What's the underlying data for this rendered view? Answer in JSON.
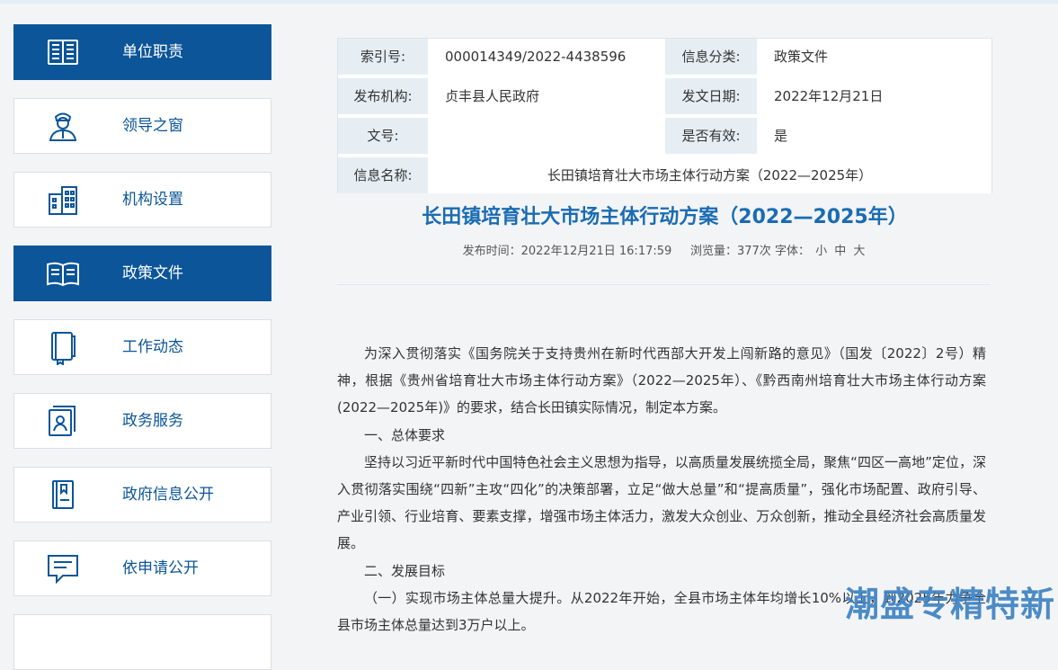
{
  "sidebar": {
    "items": [
      {
        "label": "单位职责",
        "icon": "book-list-icon",
        "active": true
      },
      {
        "label": "领导之窗",
        "icon": "leader-person-icon",
        "active": false
      },
      {
        "label": "机构设置",
        "icon": "building-icon",
        "active": false
      },
      {
        "label": "政策文件",
        "icon": "open-book-icon",
        "active": true
      },
      {
        "label": "工作动态",
        "icon": "notebook-icon",
        "active": false
      },
      {
        "label": "政务服务",
        "icon": "id-card-icon",
        "active": false
      },
      {
        "label": "政府信息公开",
        "icon": "document-icon",
        "active": false
      },
      {
        "label": "依申请公开",
        "icon": "chat-bubble-icon",
        "active": false
      }
    ]
  },
  "meta": {
    "index_label": "索引号:",
    "index_value": "000014349/2022-4438596",
    "category_label": "信息分类:",
    "category_value": "政策文件",
    "issuer_label": "发布机构:",
    "issuer_value": "贞丰县人民政府",
    "date_label": "发文日期:",
    "date_value": "2022年12月21日",
    "docno_label": "文号:",
    "docno_value": "",
    "valid_label": "是否有效:",
    "valid_value": "是",
    "name_label": "信息名称:",
    "name_value": "长田镇培育壮大市场主体行动方案（2022—2025年）"
  },
  "article": {
    "title": "长田镇培育壮大市场主体行动方案（2022—2025年）",
    "publish_label": "发布时间：",
    "publish_time": "2022年12月21日 16:17:59",
    "views_label": "浏览量：",
    "views": "377次",
    "font_label": "字体：",
    "font_small": "小",
    "font_medium": "中",
    "font_large": "大",
    "paragraphs": [
      "为深入贯彻落实《国务院关于支持贵州在新时代西部大开发上闯新路的意见》（国发〔2022〕2号）精神，根据《贵州省培育壮大市场主体行动方案》（2022—2025年）、《黔西南州培育壮大市场主体行动方案(2022—2025年)》的要求，结合长田镇实际情况，制定本方案。",
      "一、总体要求",
      "坚持以习近平新时代中国特色社会主义思想为指导，以高质量发展统揽全局，聚焦“四区一高地”定位，深入贯彻落实围绕“四新”主攻“四化”的决策部署，立足“做大总量”和“提高质量”，强化市场配置、政府引导、产业引领、行业培育、要素支撑，增强市场主体活力，激发大众创业、万众创新，推动全县经济社会高质量发展。",
      "二、发展目标",
      "（一）实现市场主体总量大提升。从2022年开始，全县市场主体年均增长10%以上，到2025年力争全县市场主体总量达到3万户以上。"
    ]
  },
  "watermark": "潮盛专精特新",
  "colors": {
    "brand": "#0b5598",
    "title": "#1a6cb2",
    "label_bg": "#e6eef4"
  }
}
